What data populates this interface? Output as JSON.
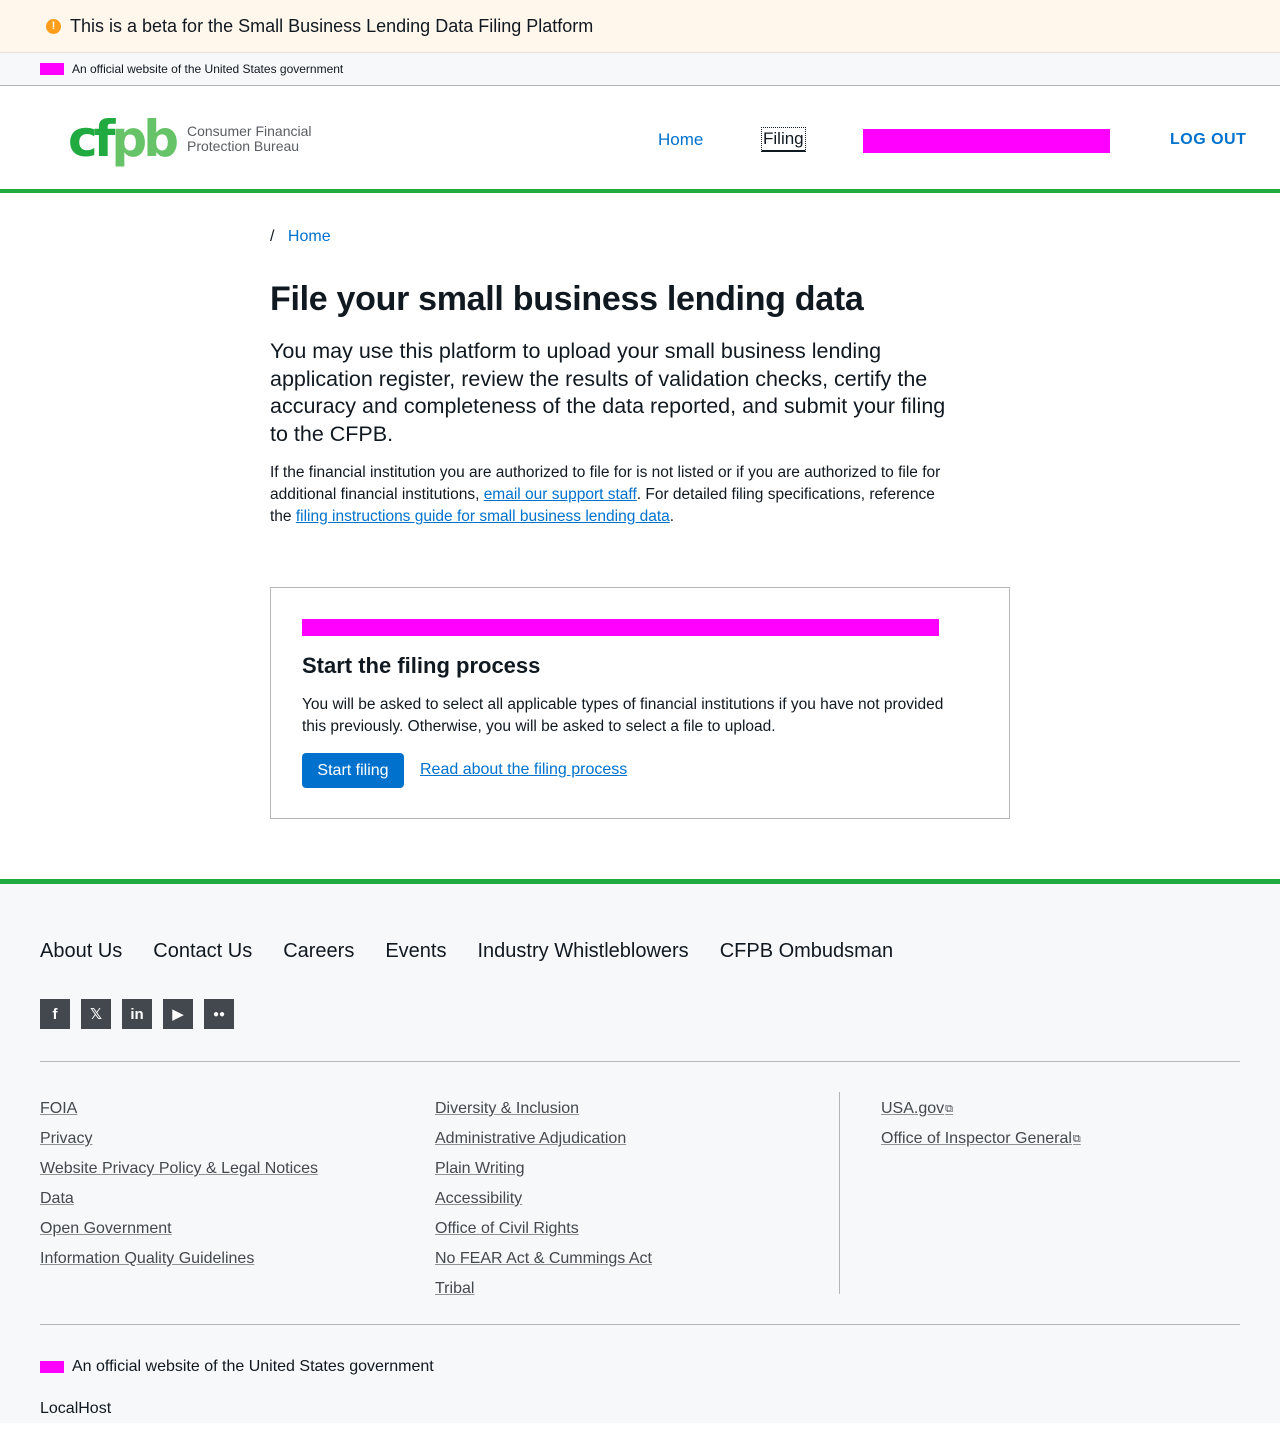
{
  "banner": {
    "icon": "!",
    "text": "This is a beta for the Small Business Lending Data Filing Platform"
  },
  "gov_bar": {
    "text": "An official website of the United States government"
  },
  "header": {
    "logo_mark_a": "cf",
    "logo_mark_b": "pb",
    "logo_line1": "Consumer Financial",
    "logo_line2": "Protection Bureau",
    "nav_home": "Home",
    "nav_filing": "Filing",
    "logout": "LOG OUT"
  },
  "breadcrumb": {
    "separator": "/",
    "home": "Home"
  },
  "main": {
    "title": "File your small business lending data",
    "lead": "You may use this platform to upload your small business lending application register, review the results of validation checks, certify the accuracy and completeness of the data reported, and submit your filing to the CFPB.",
    "body_pre": "If the financial institution you are authorized to file for is not listed or if you are authorized to file for additional financial institutions, ",
    "body_link1": "email our support staff",
    "body_mid": ". For detailed filing specifications, reference the ",
    "body_link2": "filing instructions guide for small business lending data",
    "body_post": "."
  },
  "card": {
    "title": "Start the filing process",
    "description": "You will be asked to select all applicable types of financial institutions if you have not provided this previously. Otherwise, you will be asked to select a file to upload.",
    "button": "Start filing",
    "link": "Read about the filing process"
  },
  "footer": {
    "nav": [
      "About Us",
      "Contact Us",
      "Careers",
      "Events",
      "Industry Whistleblowers",
      "CFPB Ombudsman"
    ],
    "social": [
      {
        "name": "facebook-icon",
        "glyph": "f"
      },
      {
        "name": "x-icon",
        "glyph": "𝕏"
      },
      {
        "name": "linkedin-icon",
        "glyph": "in"
      },
      {
        "name": "youtube-icon",
        "glyph": "▶"
      },
      {
        "name": "flickr-icon",
        "glyph": "●●"
      }
    ],
    "col1": [
      "FOIA",
      "Privacy",
      "Website Privacy Policy & Legal Notices",
      "Data",
      "Open Government",
      "Information Quality Guidelines"
    ],
    "col2": [
      "Diversity & Inclusion",
      "Administrative Adjudication",
      "Plain Writing",
      "Accessibility",
      "Office of Civil Rights",
      "No FEAR Act & Cummings Act",
      "Tribal"
    ],
    "col3": [
      "USA.gov",
      "Office of Inspector General"
    ],
    "external_glyph": "⧉",
    "gov_text": "An official website of the United States government",
    "env": "LocalHost"
  },
  "colors": {
    "accent": "#0072ce",
    "brand_green": "#20aa3f",
    "banner_bg": "#fff6ec",
    "warning": "#ff9e1b",
    "redaction": "#ff00ff"
  }
}
